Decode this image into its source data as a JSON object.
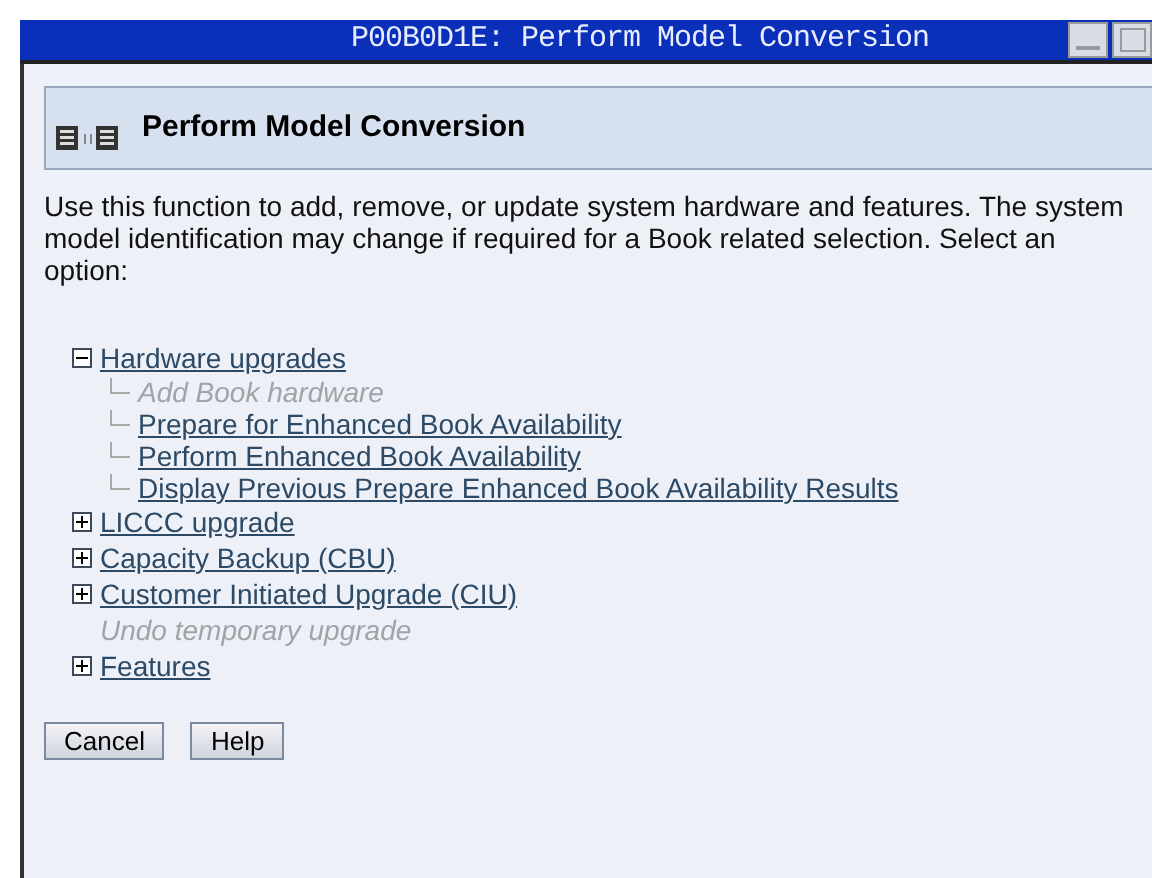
{
  "window": {
    "title": "P00B0D1E: Perform Model Conversion"
  },
  "header": {
    "title": "Perform Model Conversion"
  },
  "intro": "Use this function to add, remove, or update system hardware and features. The system model identification may change if required for a Book related selection. Select an option:",
  "tree": [
    {
      "label": "Hardware upgrades",
      "expanded": true,
      "disabled": false,
      "children": [
        {
          "label": "Add Book hardware",
          "disabled": true
        },
        {
          "label": "Prepare for Enhanced Book Availability",
          "disabled": false
        },
        {
          "label": "Perform Enhanced Book Availability",
          "disabled": false
        },
        {
          "label": "Display Previous Prepare Enhanced Book Availability Results",
          "disabled": false
        }
      ]
    },
    {
      "label": "LICCC upgrade",
      "expanded": false,
      "disabled": false
    },
    {
      "label": "Capacity Backup (CBU)",
      "expanded": false,
      "disabled": false
    },
    {
      "label": "Customer Initiated Upgrade (CIU)",
      "expanded": false,
      "disabled": false
    },
    {
      "label": "Undo temporary upgrade",
      "disabled": true
    },
    {
      "label": "Features",
      "expanded": false,
      "disabled": false
    }
  ],
  "buttons": [
    {
      "label": "Cancel"
    },
    {
      "label": "Help"
    }
  ]
}
